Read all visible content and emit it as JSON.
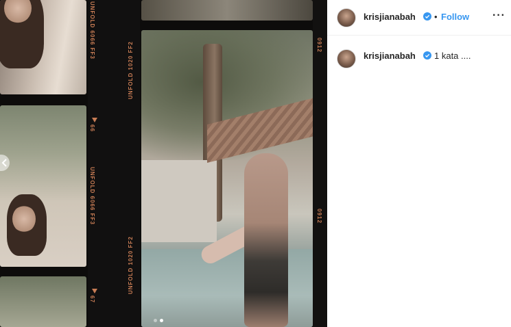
{
  "photo": {
    "film_labels": {
      "left_top": "UNFOLD 6066 FF3",
      "left_mid": "UNFOLD 6066 FF3",
      "left_bottom": "UNFOLD 1020 FF2",
      "right_top": "UNFOLD 1020 FF2",
      "frame_num_1": "66",
      "frame_num_2": "67",
      "edge_1": "0912",
      "edge_2": "0912"
    },
    "carousel": {
      "dot_count": 2,
      "active_index": 1
    }
  },
  "header": {
    "username": "krisjianabah",
    "separator": "•",
    "follow_label": "Follow",
    "more_label": "···"
  },
  "comment": {
    "username": "krisjianabah",
    "text": "1 kata ...."
  },
  "colors": {
    "follow_blue": "#3897f0",
    "verified_blue": "#3897f0",
    "film_orange": "#c97d55"
  },
  "icons": {
    "verified": "verified-badge-icon",
    "more": "more-options-icon",
    "carousel_prev": "chevron-left-icon"
  }
}
